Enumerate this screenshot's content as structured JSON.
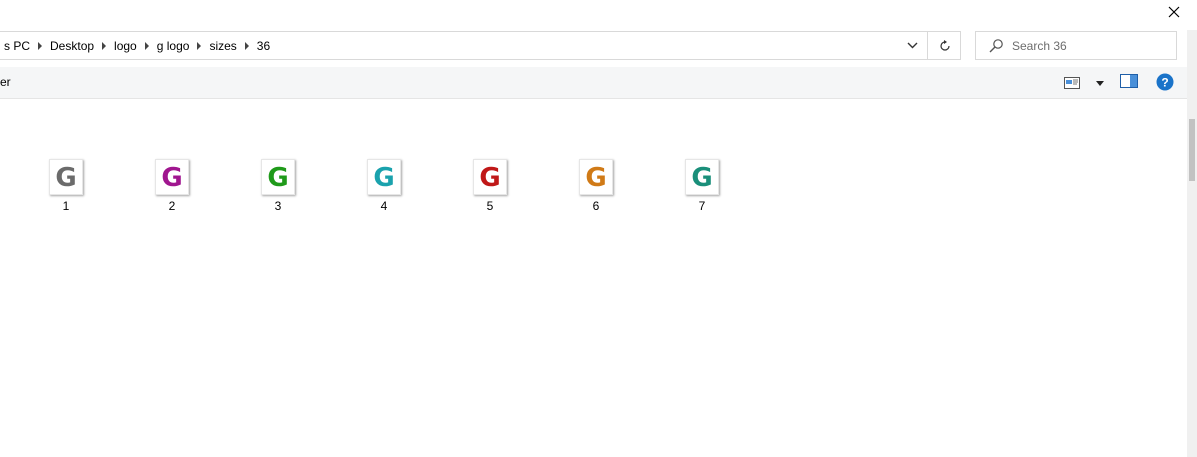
{
  "window": {
    "close_label": "✕"
  },
  "address": {
    "breadcrumb": [
      "s PC",
      "Desktop",
      "logo",
      "g logo",
      "sizes",
      "36"
    ]
  },
  "search": {
    "placeholder": "Search 36"
  },
  "toolbar": {
    "partial_label": "er"
  },
  "files": [
    {
      "name": "1",
      "color": "#6b6b6b"
    },
    {
      "name": "2",
      "color": "#a0168f"
    },
    {
      "name": "3",
      "color": "#1f9a1a"
    },
    {
      "name": "4",
      "color": "#1aa2ad"
    },
    {
      "name": "5",
      "color": "#c01818"
    },
    {
      "name": "6",
      "color": "#d07a17"
    },
    {
      "name": "7",
      "color": "#1a8f7a"
    }
  ],
  "colors": {
    "accent": "#0063b1",
    "help_blue": "#1a73c9"
  }
}
